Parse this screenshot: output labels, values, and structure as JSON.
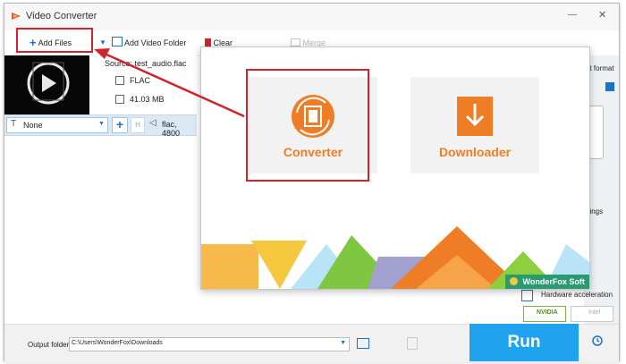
{
  "window": {
    "title": "Video Converter",
    "minimize_glyph": "—",
    "close_glyph": "✕"
  },
  "toolbar": {
    "add_files": "Add Files",
    "add_video_folder": "Add Video Folder",
    "clear": "Clear",
    "merge": "Merge"
  },
  "file": {
    "source": "Source: test_audio.flac",
    "format": "FLAC",
    "size": "41.03 MB"
  },
  "file_options": {
    "subtitle_value": "None",
    "audio_value": "flac, 4800"
  },
  "right_panel": {
    "output_format_label": "ut format",
    "settings_label": "ttings",
    "hardware_acceleration": "Hardware acceleration",
    "nvidia": "NVIDIA",
    "intel": "Intel"
  },
  "bottom": {
    "output_folder_label": "Output folder:",
    "output_folder_value": "C:\\Users\\WonderFox\\Downloads",
    "run": "Run"
  },
  "launcher": {
    "converter": "Converter",
    "downloader": "Downloader",
    "brand": "WonderFox Soft"
  },
  "colors": {
    "accent_orange": "#ef7d25",
    "run_blue": "#1fa3ee",
    "highlight_red": "#d1232a",
    "brand_green": "#2a9a70"
  },
  "icons": {
    "app": "app-logo-icon",
    "add": "plus-icon",
    "folder": "folder-add-icon",
    "clear": "trash-icon",
    "merge": "merge-icon",
    "converter": "film-convert-icon",
    "downloader": "download-icon",
    "alarm": "alarm-clock-icon"
  }
}
